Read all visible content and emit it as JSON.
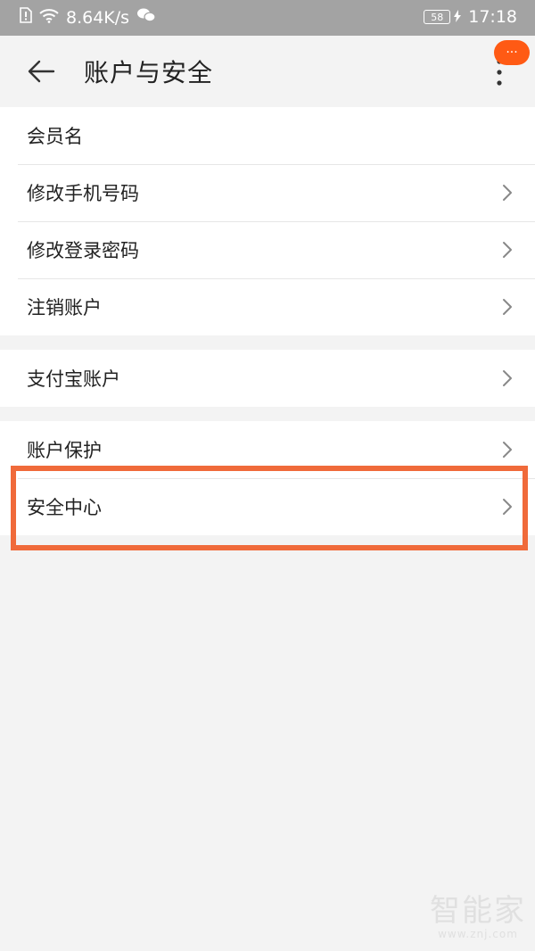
{
  "status_bar": {
    "net_speed": "8.64K/s",
    "battery": "58",
    "time": "17:18"
  },
  "header": {
    "title": "账户与安全",
    "badge": "···"
  },
  "groups": [
    {
      "items": [
        {
          "label": "会员名",
          "has_chevron": false
        },
        {
          "label": "修改手机号码",
          "has_chevron": true
        },
        {
          "label": "修改登录密码",
          "has_chevron": true
        },
        {
          "label": "注销账户",
          "has_chevron": true
        }
      ]
    },
    {
      "items": [
        {
          "label": "支付宝账户",
          "has_chevron": true
        }
      ]
    },
    {
      "items": [
        {
          "label": "账户保护",
          "has_chevron": true
        },
        {
          "label": "安全中心",
          "has_chevron": true
        }
      ]
    }
  ],
  "highlight_color": "#f06a3a",
  "accent_color": "#ff5a14",
  "watermark": {
    "main": "智能家",
    "sub": "www.znj.com"
  }
}
